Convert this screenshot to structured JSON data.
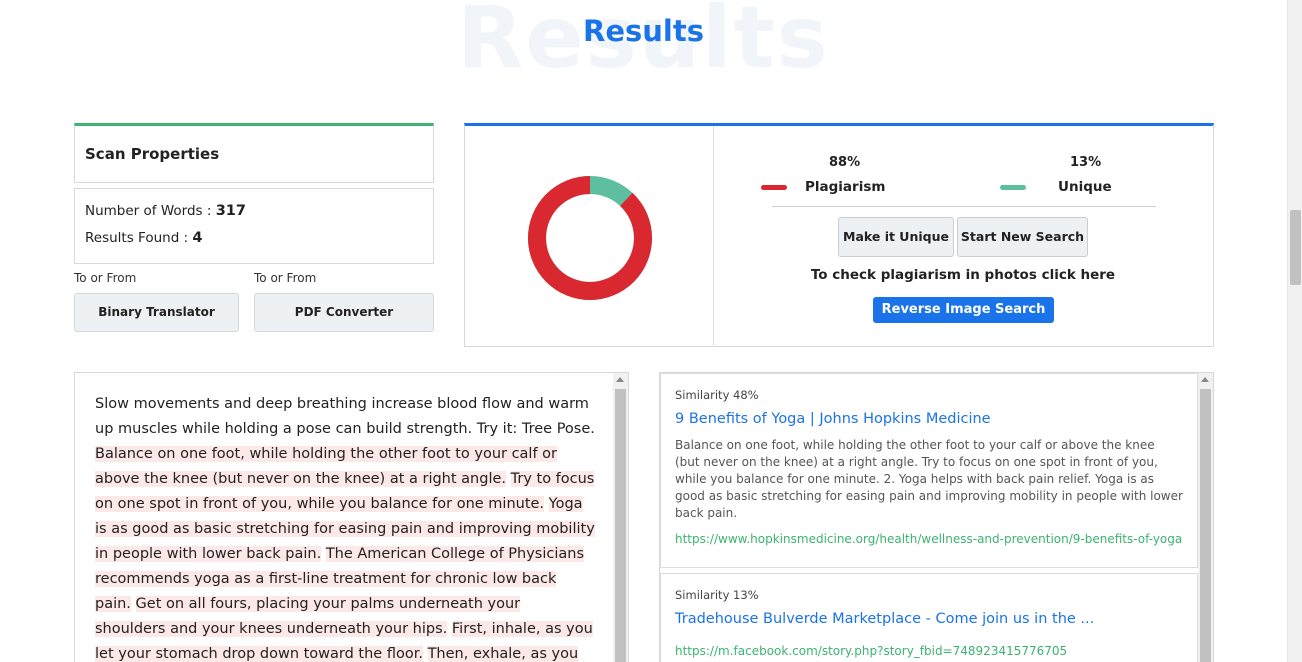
{
  "header": {
    "watermark": "Results",
    "title": "Results"
  },
  "scan_properties": {
    "title": "Scan Properties",
    "words_label": "Number of Words : ",
    "words_value": "317",
    "results_label": "Results Found : ",
    "results_value": "4"
  },
  "tools": [
    {
      "caption": "To or From",
      "label": "Binary Translator"
    },
    {
      "caption": "To or From",
      "label": "PDF Converter"
    }
  ],
  "summary": {
    "plagiarism_pct": "88%",
    "plagiarism_label": "Plagiarism",
    "unique_pct": "13%",
    "unique_label": "Unique",
    "plagiarism_fraction": 0.88,
    "plagiarism_color": "#d9282f",
    "unique_color": "#5dbf9f",
    "make_unique": "Make it Unique",
    "new_search": "Start New Search",
    "photos_text": "To check plagiarism in photos click here",
    "reverse_image": "Reverse Image Search"
  },
  "checked_text": {
    "plain_intro": "Slow movements and deep breathing increase blood flow and warm up muscles while holding a pose can build strength. Try it: Tree Pose. ",
    "highlighted": [
      "Balance on one foot, while holding the other foot to your calf or above the knee (but never on the knee) at a right angle.",
      "Try to focus on one spot in front of you, while you balance for one minute.",
      "Yoga is as good as basic stretching for easing pain and improving mobility in people with lower back pain.",
      "The American College of Physicians recommends yoga as a first-line treatment for chronic low back pain.",
      "Get on all fours, placing your palms underneath your shoulders and your knees underneath your hips.",
      "First, inhale, as you let your stomach drop down toward the floor.",
      "Then, exhale, as you draw your navel"
    ]
  },
  "sources": [
    {
      "similarity": "Similarity 48%",
      "title": "9 Benefits of Yoga | Johns Hopkins Medicine",
      "excerpt": "Balance on one foot, while holding the other foot to your calf or above the knee (but never on the knee) at a right angle. Try to focus on one spot in front of you, while you balance for one minute. 2. Yoga helps with back pain relief. Yoga is as good as basic stretching for easing pain and improving mobility in people with lower back pain.",
      "url": "https://www.hopkinsmedicine.org/health/wellness-and-prevention/9-benefits-of-yoga"
    },
    {
      "similarity": "Similarity 13%",
      "title": "Tradehouse Bulverde Marketplace - Come join us in the ...",
      "excerpt": "",
      "url": "https://m.facebook.com/story.php?story_fbid=748923415776705"
    }
  ]
}
